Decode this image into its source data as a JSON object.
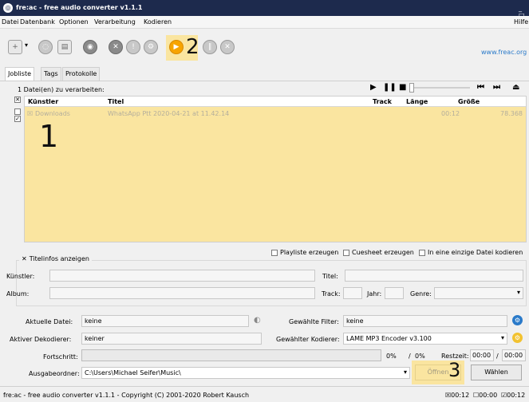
{
  "window": {
    "title": "fre:ac - free audio converter v1.1.1",
    "controls": "_ □ X"
  },
  "menu": [
    "Datei",
    "Datenbank",
    "Optionen",
    "Verarbeitung",
    "Kodieren"
  ],
  "help_menu": "Hilfe",
  "toolbar": {
    "website": "www.freac.org"
  },
  "tabs": [
    "Jobliste",
    "Tags",
    "Protokolle"
  ],
  "joblist": {
    "count_text": "1 Datei(en) zu verarbeiten:",
    "columns": [
      "Künstler",
      "Titel",
      "Track",
      "Länge",
      "Größe"
    ],
    "rows": [
      {
        "artist": "Downloads",
        "title": "WhatsApp Ptt 2020-04-21 at 11.42.14",
        "track": "",
        "length": "00:12",
        "size": "78.368"
      }
    ]
  },
  "options": {
    "playlist": "Playliste erzeugen",
    "cuesheet": "Cuesheet erzeugen",
    "single_file": "In eine einzige Datei kodieren"
  },
  "titleinfo": {
    "label": "Titelinfos anzeigen",
    "artist_label": "Künstler:",
    "title_label": "Titel:",
    "album_label": "Album:",
    "track_label": "Track:",
    "year_label": "Jahr:",
    "genre_label": "Genre:"
  },
  "status_panel": {
    "current_file_label": "Aktuelle Datei:",
    "current_file_value": "keine",
    "decoder_label": "Aktiver Dekodierer:",
    "decoder_value": "keiner",
    "filter_label": "Gewählte Filter:",
    "filter_value": "keine",
    "encoder_label": "Gewählter Kodierer:",
    "encoder_value": "LAME MP3 Encoder v3.100",
    "progress_label": "Fortschritt:",
    "percent1": "0%",
    "slash": "/",
    "percent2": "0%",
    "remaining_label": "Restzeit:",
    "remaining_value": "00:00",
    "total_value": "00:00",
    "output_label": "Ausgabeordner:",
    "output_value": "C:\\Users\\Michael Seifer\\Music\\",
    "open_button": "Öffnen",
    "choose_button": "Wählen"
  },
  "statusbar": {
    "text": "fre:ac - free audio converter v1.1.1 - Copyright (C) 2001-2020 Robert Kausch",
    "t1": "00:12",
    "t2": "00:00",
    "t3": "00:12"
  },
  "annotations": {
    "n1": "1",
    "n2": "2",
    "n3": "3"
  },
  "colors": {
    "highlight": "#fae5a0",
    "titlebar": "#1d2a4d",
    "active_icon": "#f7a400",
    "link": "#2a7ac9"
  }
}
